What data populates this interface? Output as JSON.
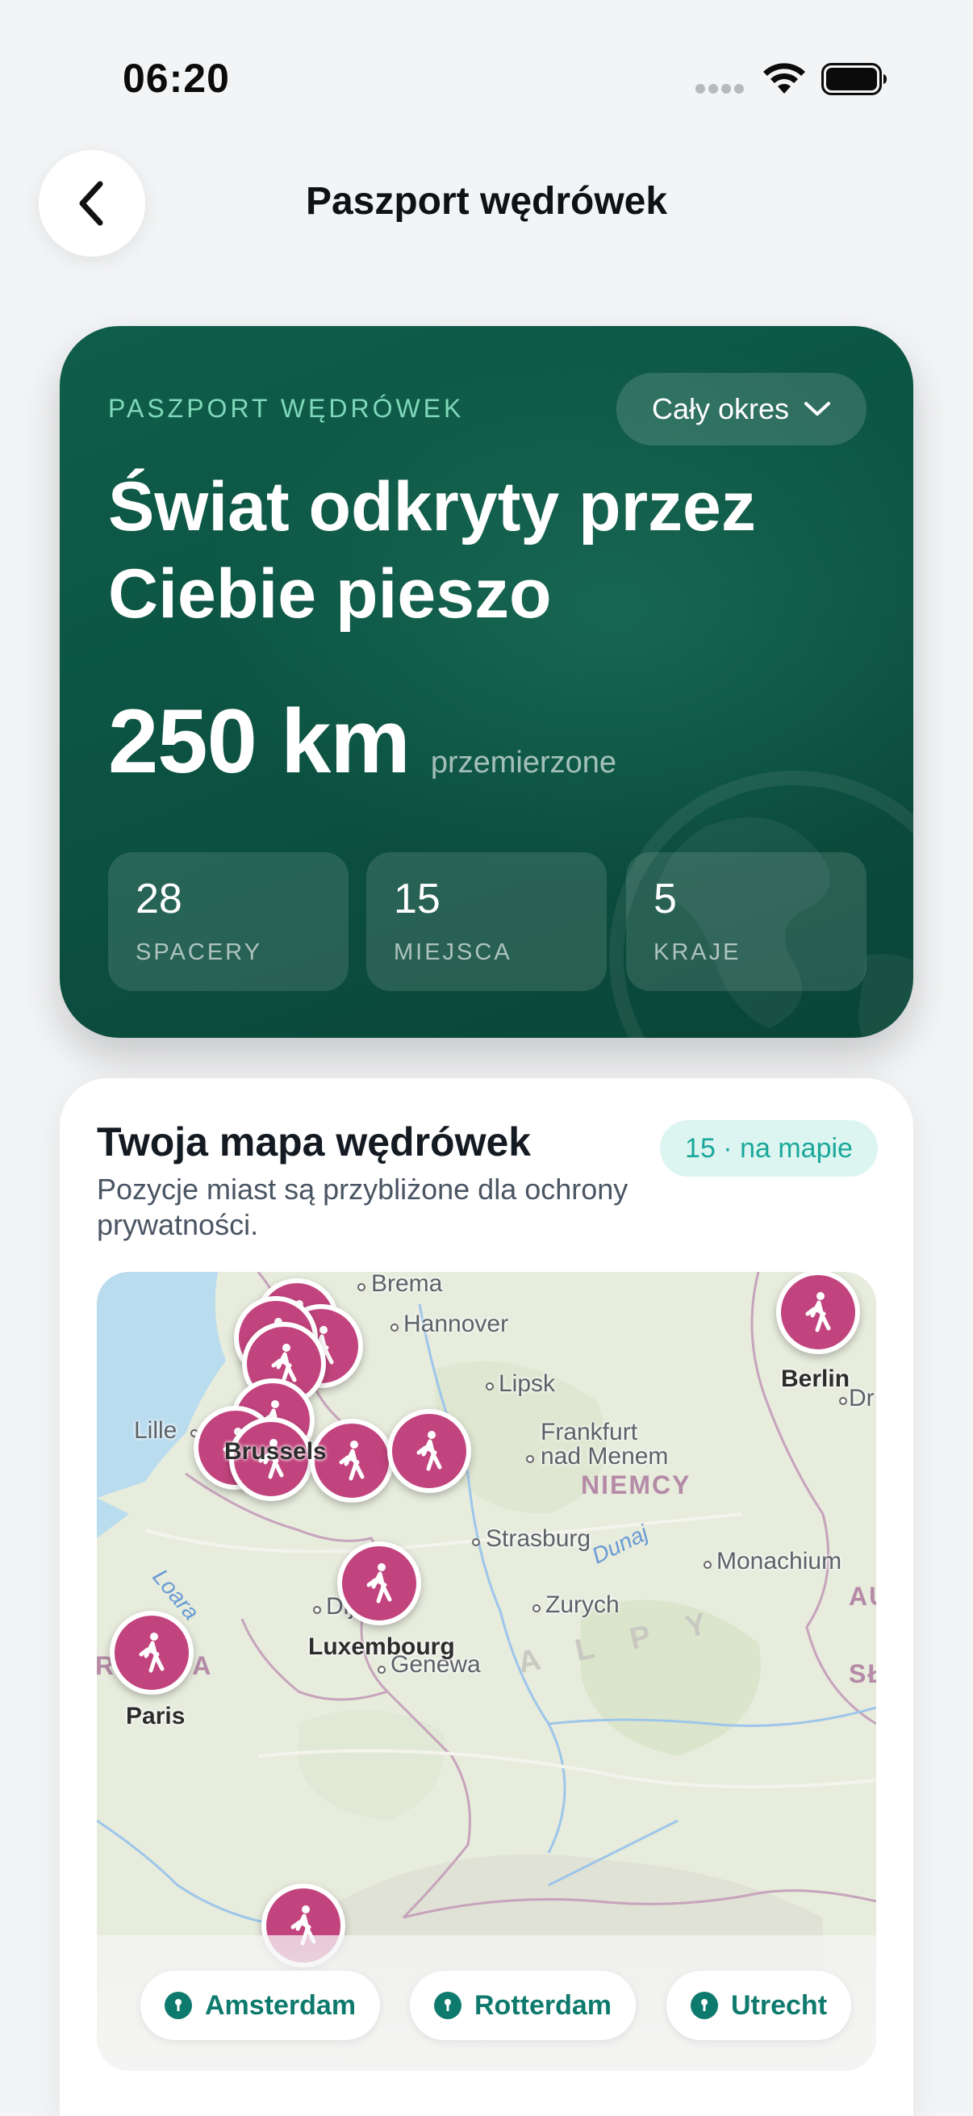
{
  "status_bar": {
    "time": "06:20"
  },
  "header": {
    "title": "Paszport wędrówek"
  },
  "hero": {
    "eyebrow": "PASZPORT WĘDRÓWEK",
    "period_label": "Cały okres",
    "headline_line1": "Świat odkryty przez",
    "headline_line2": "Ciebie pieszo",
    "distance_value": "250 km",
    "distance_caption": "przemierzone",
    "stats": [
      {
        "value": "28",
        "label": "SPACERY"
      },
      {
        "value": "15",
        "label": "MIEJSCA"
      },
      {
        "value": "5",
        "label": "KRAJE"
      }
    ]
  },
  "map_card": {
    "title": "Twoja mapa wędrówek",
    "count_label": "15 · na mapie",
    "subtitle": "Pozycje miast są przybliżone dla ochrony prywatności.",
    "map_labels": {
      "cities": [
        "Brussels",
        "Luxembourg",
        "Paris",
        "Berlin"
      ],
      "places": [
        "Brema",
        "Hannover",
        "Lipsk",
        "Dr",
        "Lille",
        "Frankfurt",
        "nad Menem",
        "Strasburg",
        "Monachium",
        "Dijon",
        "Zurych",
        "Genewa"
      ],
      "countries": [
        "NIEMCY",
        "RANCJA",
        "AU",
        "SŁ",
        "A L P Y"
      ],
      "rivers": [
        "Dunaj",
        "Loara"
      ]
    },
    "chips": [
      "Amsterdam",
      "Rotterdam",
      "Utrecht"
    ]
  },
  "colors": {
    "hero_bg": "#0c5443",
    "accent_mint": "#7fd8b9",
    "pin": "#c2447e",
    "chip_text": "#0e7a6d",
    "count_pill_bg": "#dcf5f1"
  }
}
